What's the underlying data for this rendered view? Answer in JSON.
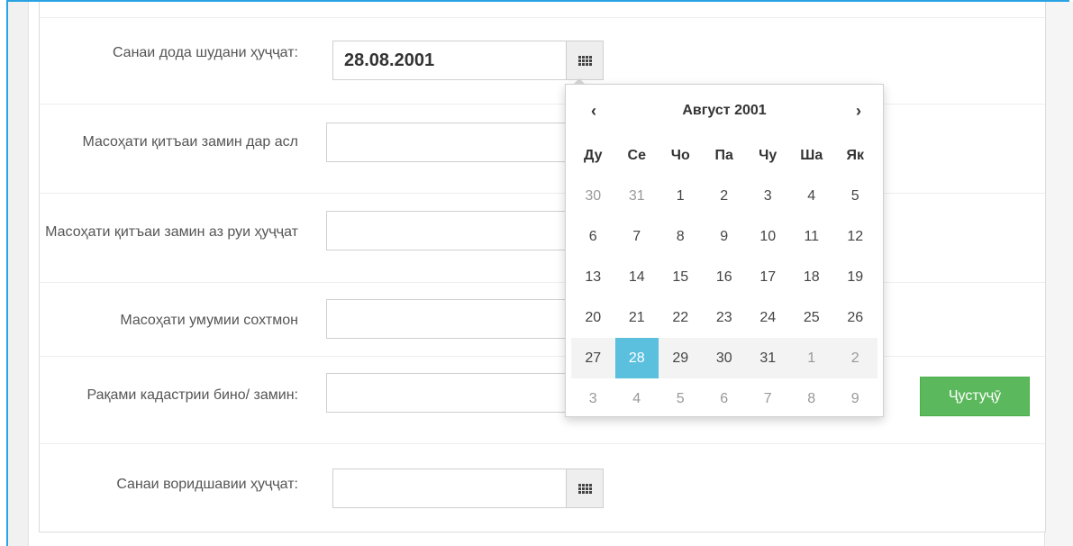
{
  "form": {
    "issue_date_label": "Санаи дода шудани ҳуҷҷат:",
    "issue_date_value": "28.08.2001",
    "area_original_label": "Масоҳати қитъаи замин дар асл",
    "area_document_label": "Масоҳати қитъаи замин аз руи ҳуҷҷат",
    "building_area_label": "Масоҳати умумии сохтмон",
    "cadastral_label": "Рақами кадастрии бино/ замин:",
    "entry_date_label": "Санаи воридшавии ҳуҷҷат:",
    "search_button": "Ҷустуҷӯ"
  },
  "datepicker": {
    "prev": "‹",
    "next": "›",
    "title": "Август 2001",
    "weekdays": [
      "Ду",
      "Се",
      "Чо",
      "Па",
      "Чу",
      "Ша",
      "Як"
    ],
    "weeks": [
      [
        {
          "d": "30",
          "o": true
        },
        {
          "d": "31",
          "o": true
        },
        {
          "d": "1"
        },
        {
          "d": "2"
        },
        {
          "d": "3"
        },
        {
          "d": "4"
        },
        {
          "d": "5"
        }
      ],
      [
        {
          "d": "6"
        },
        {
          "d": "7"
        },
        {
          "d": "8"
        },
        {
          "d": "9"
        },
        {
          "d": "10"
        },
        {
          "d": "11"
        },
        {
          "d": "12"
        }
      ],
      [
        {
          "d": "13"
        },
        {
          "d": "14"
        },
        {
          "d": "15"
        },
        {
          "d": "16"
        },
        {
          "d": "17"
        },
        {
          "d": "18"
        },
        {
          "d": "19"
        }
      ],
      [
        {
          "d": "20"
        },
        {
          "d": "21"
        },
        {
          "d": "22"
        },
        {
          "d": "23"
        },
        {
          "d": "24"
        },
        {
          "d": "25"
        },
        {
          "d": "26"
        }
      ],
      [
        {
          "d": "27"
        },
        {
          "d": "28",
          "a": true
        },
        {
          "d": "29"
        },
        {
          "d": "30"
        },
        {
          "d": "31"
        },
        {
          "d": "1",
          "o": true
        },
        {
          "d": "2",
          "o": true
        }
      ],
      [
        {
          "d": "3",
          "o": true
        },
        {
          "d": "4",
          "o": true
        },
        {
          "d": "5",
          "o": true
        },
        {
          "d": "6",
          "o": true
        },
        {
          "d": "7",
          "o": true
        },
        {
          "d": "8",
          "o": true
        },
        {
          "d": "9",
          "o": true
        }
      ]
    ],
    "highlighted_week": 4
  },
  "colors": {
    "frame": "#29a3e3",
    "active_day": "#5bc0de",
    "search_button": "#5cb85c"
  },
  "icons": {
    "calendar_addon": "calendar-grid-icon"
  }
}
